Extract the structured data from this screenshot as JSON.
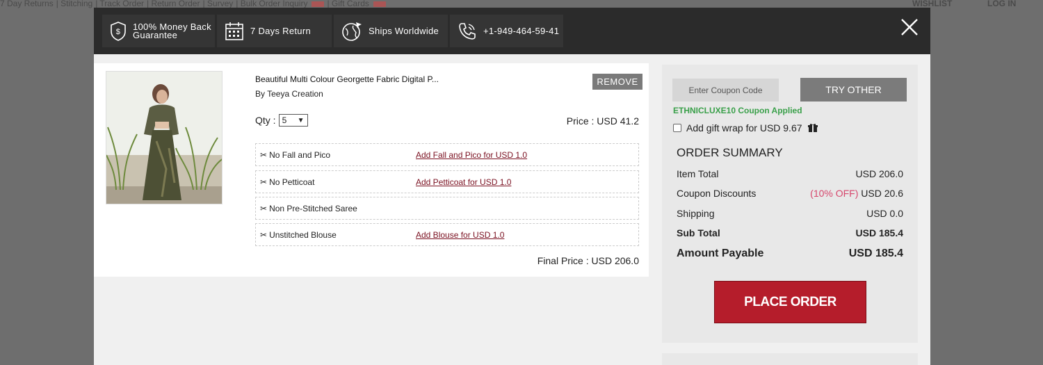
{
  "background": {
    "links": [
      "7 Day Returns",
      "Stitching",
      "Track Order",
      "Return Order",
      "Survey",
      "Bulk Order Inquiry",
      "Gift Cards"
    ],
    "wishlist": "WISHLIST",
    "login": "LOG IN"
  },
  "header": {
    "features": [
      {
        "line1": "100% Money Back",
        "line2": "Guarantee",
        "icon": "shield-money-icon"
      },
      {
        "line1": "7 Days Return",
        "icon": "calendar-icon"
      },
      {
        "line1": "Ships Worldwide",
        "icon": "globe-plane-icon"
      },
      {
        "line1": "+1-949-464-59-41",
        "icon": "phone-icon"
      }
    ],
    "close": "close-icon"
  },
  "cart": {
    "product_name": "Beautiful Multi Colour Georgette Fabric Digital P...",
    "product_by": "By Teeya Creation",
    "remove_label": "REMOVE",
    "qty_label": "Qty :",
    "qty_value": "5",
    "price": "Price : USD 41.2",
    "options": [
      {
        "label": "No Fall and Pico",
        "link": "Add Fall and Pico for USD 1.0"
      },
      {
        "label": "No Petticoat",
        "link": "Add Petticoat for USD 1.0"
      },
      {
        "label": "Non Pre-Stitched Saree",
        "link": ""
      },
      {
        "label": "Unstitched Blouse",
        "link": "Add Blouse for USD 1.0"
      }
    ],
    "final_price": "Final Price : USD 206.0"
  },
  "summary": {
    "coupon_placeholder": "Enter Coupon Code",
    "try_other": "TRY OTHER",
    "coupon_applied": "ETHNICLUXE10 Coupon Applied",
    "gift_wrap": "Add gift wrap for USD 9.67",
    "title": "ORDER SUMMARY",
    "item_total_label": "Item Total",
    "item_total_value": "USD 206.0",
    "coupon_discount_label": "Coupon Discounts",
    "coupon_discount_pct": "(10% OFF)",
    "coupon_discount_value": "USD 20.6",
    "shipping_label": "Shipping",
    "shipping_value": "USD 0.0",
    "subtotal_label": "Sub Total",
    "subtotal_value": "USD 185.4",
    "payable_label": "Amount Payable",
    "payable_value": "USD 185.4",
    "place_order": "PLACE ORDER"
  },
  "colors": {
    "header_bg": "#2b2b2b",
    "feature_bg": "#353535",
    "place_order_bg": "#b51d2b",
    "coupon_green": "#3aa04a",
    "discount_pink": "#d6456b",
    "link_maroon": "#7a1020"
  }
}
